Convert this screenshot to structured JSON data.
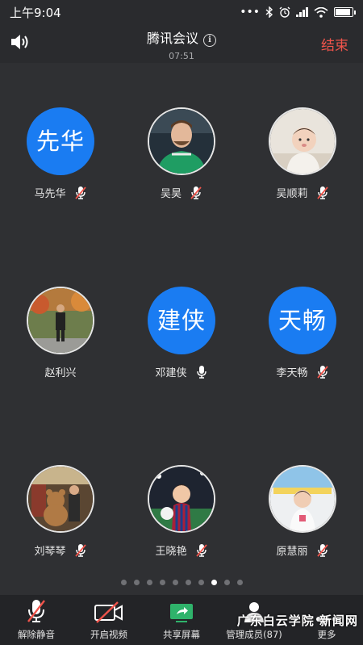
{
  "status_bar": {
    "time": "上午9:04",
    "dots": "•••"
  },
  "header": {
    "title": "腾讯会议",
    "timer": "07:51",
    "end_label": "结束"
  },
  "participants": [
    {
      "name": "马先华",
      "avatar_text": "先华",
      "mic": "muted"
    },
    {
      "name": "吴昊",
      "avatar_text": "",
      "mic": "muted"
    },
    {
      "name": "吴顺莉",
      "avatar_text": "",
      "mic": "muted"
    },
    {
      "name": "赵利兴",
      "avatar_text": "",
      "mic": "none"
    },
    {
      "name": "邓建侠",
      "avatar_text": "建侠",
      "mic": "on"
    },
    {
      "name": "李天畅",
      "avatar_text": "天畅",
      "mic": "muted"
    },
    {
      "name": "刘琴琴",
      "avatar_text": "",
      "mic": "muted"
    },
    {
      "name": "王晓艳",
      "avatar_text": "",
      "mic": "muted"
    },
    {
      "name": "原慧丽",
      "avatar_text": "",
      "mic": "muted"
    }
  ],
  "pagination": {
    "total": 10,
    "active_index": 7
  },
  "toolbar": {
    "unmute": "解除静音",
    "video": "开启视频",
    "share": "共享屏幕",
    "members": "管理成员(87)",
    "more": "更多"
  },
  "watermark": "广东白云学院 新闻网",
  "colors": {
    "accent_blue": "#1a7cf2",
    "end_red": "#f0544b",
    "share_green": "#2fb36b"
  }
}
